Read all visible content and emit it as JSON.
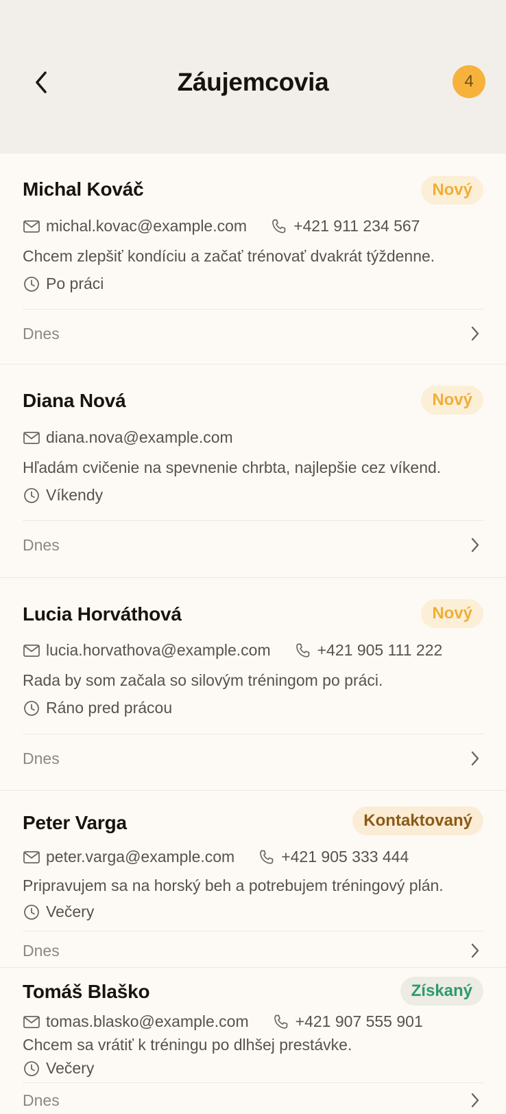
{
  "header": {
    "title": "Záujemcovia",
    "count": "4"
  },
  "leads": [
    {
      "name": "Michal Kováč",
      "status": "Nový",
      "email": "michal.kovac@example.com",
      "phone": "+421 911 234 567",
      "message": "Chcem zlepšiť kondíciu a začať trénovať dvakrát týždenne.",
      "preferred_time": "Po práci",
      "date": "Dnes"
    },
    {
      "name": "Diana Nová",
      "status": "Nový",
      "email": "diana.nova@example.com",
      "phone": "",
      "message": "Hľadám cvičenie na spevnenie chrbta, najlepšie cez víkend.",
      "preferred_time": "Víkendy",
      "date": "Dnes"
    },
    {
      "name": "Lucia Horváthová",
      "status": "Nový",
      "email": "lucia.horvathova@example.com",
      "phone": "+421 905 111 222",
      "message": "Rada by som začala so silovým tréningom po práci.",
      "preferred_time": "Ráno pred prácou",
      "date": "Dnes"
    },
    {
      "name": "Peter Varga",
      "status": "Kontaktovaný",
      "email": "peter.varga@example.com",
      "phone": "+421 905 333 444",
      "message": "Pripravujem sa na horský beh a potrebujem tréningový plán.",
      "preferred_time": "Večery",
      "date": "Dnes"
    },
    {
      "name": "Tomáš Blaško",
      "status": "Získaný",
      "email": "tomas.blasko@example.com",
      "phone": "+421 907 555 901",
      "message": "Chcem sa vrátiť k tréningu po dlhšej prestávke.",
      "preferred_time": "Večery",
      "date": "Dnes"
    }
  ],
  "colors": {
    "accent": "#f6b23a",
    "status_new_bg": "#fcefd7",
    "status_new_text": "#f0ae37",
    "status_contacted_bg": "#fbecd5",
    "status_contacted_text": "#8a5a17",
    "status_won_bg": "#ecebe4",
    "status_won_text": "#2e9b6b"
  },
  "icons": {
    "back": "chevron-left-icon",
    "email": "mail-icon",
    "phone": "phone-icon",
    "time": "clock-icon",
    "open": "chevron-right-icon"
  }
}
